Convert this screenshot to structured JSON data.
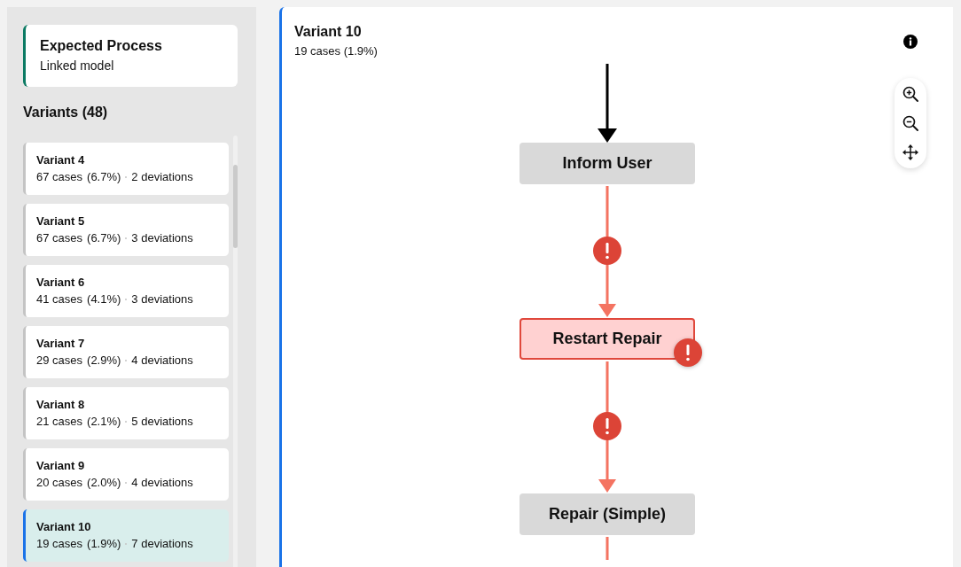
{
  "sidebar": {
    "expected_process": {
      "title": "Expected Process",
      "subtitle": "Linked model"
    },
    "variants_heading": "Variants (48)",
    "variants": [
      {
        "name": "Variant 4",
        "cases": "67 cases",
        "share": "(6.7%)",
        "deviations": "2 deviations",
        "selected": false
      },
      {
        "name": "Variant 5",
        "cases": "67 cases",
        "share": "(6.7%)",
        "deviations": "3 deviations",
        "selected": false
      },
      {
        "name": "Variant 6",
        "cases": "41 cases",
        "share": "(4.1%)",
        "deviations": "3 deviations",
        "selected": false
      },
      {
        "name": "Variant 7",
        "cases": "29 cases",
        "share": "(2.9%)",
        "deviations": "4 deviations",
        "selected": false
      },
      {
        "name": "Variant 8",
        "cases": "21 cases",
        "share": "(2.1%)",
        "deviations": "5 deviations",
        "selected": false
      },
      {
        "name": "Variant 9",
        "cases": "20 cases",
        "share": "(2.0%)",
        "deviations": "4 deviations",
        "selected": false
      },
      {
        "name": "Variant 10",
        "cases": "19 cases",
        "share": "(1.9%)",
        "deviations": "7 deviations",
        "selected": true
      }
    ]
  },
  "detail": {
    "title": "Variant 10",
    "summary": "19 cases (1.9%)",
    "flow": [
      {
        "kind": "start"
      },
      {
        "kind": "node",
        "label": "Inform User",
        "deviation": false
      },
      {
        "kind": "edge",
        "deviation": true,
        "flagged": true
      },
      {
        "kind": "node",
        "label": "Restart Repair",
        "deviation": true
      },
      {
        "kind": "edge",
        "deviation": true,
        "flagged": true
      },
      {
        "kind": "node",
        "label": "Repair (Simple)",
        "deviation": false
      },
      {
        "kind": "edge",
        "deviation": true,
        "flagged": false
      }
    ]
  }
}
